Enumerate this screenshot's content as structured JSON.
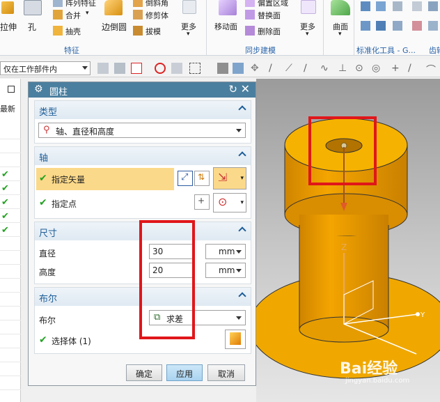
{
  "ribbon": {
    "items": {
      "extrude_partial": "拉伸",
      "hole": "孔",
      "array_feature": "阵列特征",
      "unite": "合并",
      "shell": "抽壳",
      "edge_blend": "边倒圆",
      "chamfer_partial": "倒斜角",
      "trim_body": "修剪体",
      "draft": "拔模",
      "more1": "更多",
      "move_face": "移动面",
      "offset_region_partial": "偏置区域",
      "replace_face": "替换面",
      "delete_face": "删除面",
      "more2": "更多",
      "surface": "曲面"
    },
    "groups": {
      "feature": "特征",
      "sync_modeling": "同步建模",
      "standard_tools": "标准化工具 - G...",
      "gear_partial": "齿轮"
    }
  },
  "toolbar": {
    "filter_value": "仅在工作部件内"
  },
  "navigator": {
    "header": "最新"
  },
  "dialog": {
    "title": "圆柱",
    "type_section": {
      "header": "类型",
      "value": "轴、直径和高度"
    },
    "axis_section": {
      "header": "轴",
      "specify_vector": "指定矢量",
      "specify_point": "指定点"
    },
    "size_section": {
      "header": "尺寸",
      "diameter_label": "直径",
      "diameter_value": "30",
      "diameter_unit": "mm",
      "height_label": "高度",
      "height_value": "20",
      "height_unit": "mm"
    },
    "boolean_section": {
      "header": "布尔",
      "boolean_label": "布尔",
      "boolean_value": "求差",
      "select_body": "选择体 (1)"
    },
    "buttons": {
      "ok": "确定",
      "apply": "应用",
      "cancel": "取消"
    }
  },
  "viewport": {
    "axis_z": "Z",
    "axis_y": "Y",
    "watermark": "Bai经验",
    "watermark_url": "jingyan.baidu.com"
  },
  "colors": {
    "annotation_red": "#e0161a",
    "part_orange": "#f2a400",
    "dialog_title_bar": "#4b7f9f",
    "highlight_row": "#fbd98a",
    "section_header_text": "#1d5d98"
  }
}
